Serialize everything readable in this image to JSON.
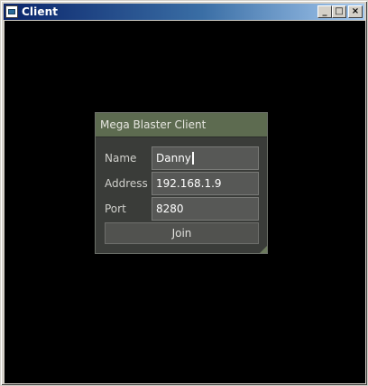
{
  "window": {
    "title": "Client",
    "icon": "app-window-icon",
    "buttons": {
      "minimize_icon": "minimize-icon",
      "maximize_icon": "maximize-icon",
      "close_icon": "close-icon",
      "minimize_glyph": "_",
      "maximize_glyph": "□",
      "close_glyph": "×"
    }
  },
  "dialog": {
    "title": "Mega Blaster Client",
    "fields": {
      "name": {
        "label": "Name",
        "value": "Danny"
      },
      "address": {
        "label": "Address",
        "value": "192.168.1.9"
      },
      "port": {
        "label": "Port",
        "value": "8280"
      }
    },
    "join_label": "Join",
    "colors": {
      "header": "#5d6b50",
      "body": "#3a3c39",
      "input": "#575856",
      "client_background": "#000000"
    }
  }
}
